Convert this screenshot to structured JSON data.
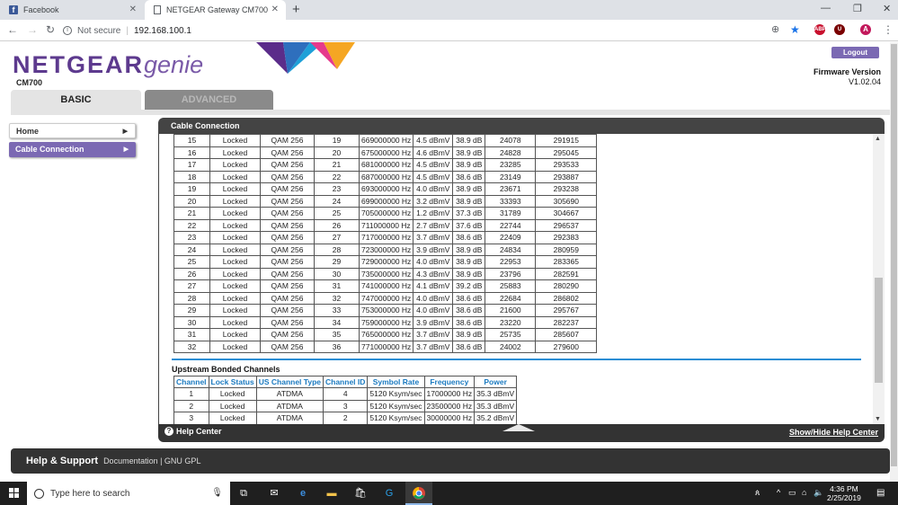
{
  "browser": {
    "tabs": [
      {
        "title": "Facebook",
        "icon": "facebook-icon"
      },
      {
        "title": "NETGEAR Gateway CM700",
        "icon": "document-icon"
      }
    ],
    "security_label": "Not secure",
    "url": "192.168.100.1",
    "profile_initial": "A",
    "ext1": "ABP",
    "ext2": "U"
  },
  "header": {
    "brand": "NETGEAR",
    "genie": "genie",
    "model": "CM700",
    "logout_label": "Logout",
    "firmware_label": "Firmware Version",
    "firmware_value": "V1.02.04"
  },
  "tabs": {
    "basic": "BASIC",
    "advanced": "ADVANCED"
  },
  "sidebar": {
    "items": [
      {
        "label": "Home"
      },
      {
        "label": "Cable Connection"
      }
    ]
  },
  "panel": {
    "title": "Cable Connection",
    "downstream_rows": [
      [
        "15",
        "Locked",
        "QAM 256",
        "19",
        "669000000 Hz",
        "4.5 dBmV",
        "38.9 dB",
        "24078",
        "291915"
      ],
      [
        "16",
        "Locked",
        "QAM 256",
        "20",
        "675000000 Hz",
        "4.6 dBmV",
        "38.9 dB",
        "24828",
        "295045"
      ],
      [
        "17",
        "Locked",
        "QAM 256",
        "21",
        "681000000 Hz",
        "4.5 dBmV",
        "38.9 dB",
        "23285",
        "293533"
      ],
      [
        "18",
        "Locked",
        "QAM 256",
        "22",
        "687000000 Hz",
        "4.5 dBmV",
        "38.6 dB",
        "23149",
        "293887"
      ],
      [
        "19",
        "Locked",
        "QAM 256",
        "23",
        "693000000 Hz",
        "4.0 dBmV",
        "38.9 dB",
        "23671",
        "293238"
      ],
      [
        "20",
        "Locked",
        "QAM 256",
        "24",
        "699000000 Hz",
        "3.2 dBmV",
        "38.9 dB",
        "33393",
        "305690"
      ],
      [
        "21",
        "Locked",
        "QAM 256",
        "25",
        "705000000 Hz",
        "1.2 dBmV",
        "37.3 dB",
        "31789",
        "304667"
      ],
      [
        "22",
        "Locked",
        "QAM 256",
        "26",
        "711000000 Hz",
        "2.7 dBmV",
        "37.6 dB",
        "22744",
        "296537"
      ],
      [
        "23",
        "Locked",
        "QAM 256",
        "27",
        "717000000 Hz",
        "3.7 dBmV",
        "38.6 dB",
        "22409",
        "292383"
      ],
      [
        "24",
        "Locked",
        "QAM 256",
        "28",
        "723000000 Hz",
        "3.9 dBmV",
        "38.9 dB",
        "24834",
        "280959"
      ],
      [
        "25",
        "Locked",
        "QAM 256",
        "29",
        "729000000 Hz",
        "4.0 dBmV",
        "38.9 dB",
        "22953",
        "283365"
      ],
      [
        "26",
        "Locked",
        "QAM 256",
        "30",
        "735000000 Hz",
        "4.3 dBmV",
        "38.9 dB",
        "23796",
        "282591"
      ],
      [
        "27",
        "Locked",
        "QAM 256",
        "31",
        "741000000 Hz",
        "4.1 dBmV",
        "39.2 dB",
        "25883",
        "280290"
      ],
      [
        "28",
        "Locked",
        "QAM 256",
        "32",
        "747000000 Hz",
        "4.0 dBmV",
        "38.6 dB",
        "22684",
        "286802"
      ],
      [
        "29",
        "Locked",
        "QAM 256",
        "33",
        "753000000 Hz",
        "4.0 dBmV",
        "38.6 dB",
        "21600",
        "295767"
      ],
      [
        "30",
        "Locked",
        "QAM 256",
        "34",
        "759000000 Hz",
        "3.9 dBmV",
        "38.6 dB",
        "23220",
        "282237"
      ],
      [
        "31",
        "Locked",
        "QAM 256",
        "35",
        "765000000 Hz",
        "3.7 dBmV",
        "38.9 dB",
        "25735",
        "285607"
      ],
      [
        "32",
        "Locked",
        "QAM 256",
        "36",
        "771000000 Hz",
        "3.7 dBmV",
        "38.6 dB",
        "24002",
        "279600"
      ]
    ],
    "upstream_title": "Upstream Bonded Channels",
    "upstream_headers": [
      "Channel",
      "Lock Status",
      "US Channel Type",
      "Channel ID",
      "Symbol Rate",
      "Frequency",
      "Power"
    ],
    "upstream_rows": [
      [
        "1",
        "Locked",
        "ATDMA",
        "4",
        "5120 Ksym/sec",
        "17000000 Hz",
        "35.3 dBmV"
      ],
      [
        "2",
        "Locked",
        "ATDMA",
        "3",
        "5120 Ksym/sec",
        "23500000 Hz",
        "35.3 dBmV"
      ],
      [
        "3",
        "Locked",
        "ATDMA",
        "2",
        "5120 Ksym/sec",
        "30000000 Hz",
        "35.2 dBmV"
      ]
    ],
    "help_center": "Help Center",
    "show_hide": "Show/Hide Help Center"
  },
  "support": {
    "title": "Help & Support",
    "links": "Documentation  | GNU GPL"
  },
  "taskbar": {
    "search_placeholder": "Type here to search",
    "time": "4:36 PM",
    "date": "2/25/2019"
  }
}
